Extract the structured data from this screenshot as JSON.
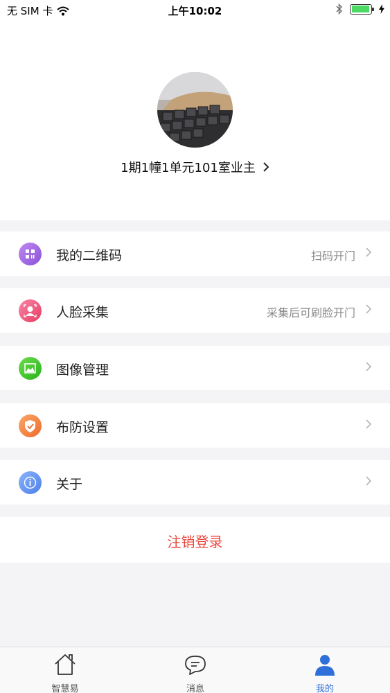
{
  "status_bar": {
    "carrier": "无 SIM 卡",
    "time": "上午10:02"
  },
  "profile": {
    "name": "1期1幢1单元101室业主"
  },
  "menu": {
    "items": [
      {
        "label": "我的二维码",
        "hint": "扫码开门",
        "icon": "qrcode-icon",
        "color": "#a66fe0"
      },
      {
        "label": "人脸采集",
        "hint": "采集后可刷脸开门",
        "icon": "face-icon",
        "color": "#ee4f7d"
      },
      {
        "label": "图像管理",
        "hint": "",
        "icon": "image-icon",
        "color": "#3cc22b"
      },
      {
        "label": "布防设置",
        "hint": "",
        "icon": "shield-icon",
        "color": "#f07a3a"
      },
      {
        "label": "关于",
        "hint": "",
        "icon": "info-icon",
        "color": "#5b8ff0"
      }
    ],
    "logout_label": "注销登录"
  },
  "tab_bar": {
    "tabs": [
      {
        "label": "智慧易",
        "icon": "home-icon",
        "active": false
      },
      {
        "label": "消息",
        "icon": "message-icon",
        "active": false
      },
      {
        "label": "我的",
        "icon": "user-icon",
        "active": true
      }
    ]
  },
  "colors": {
    "accent": "#2f6fd9",
    "logout": "#e8483f",
    "background": "#f4f4f6"
  }
}
